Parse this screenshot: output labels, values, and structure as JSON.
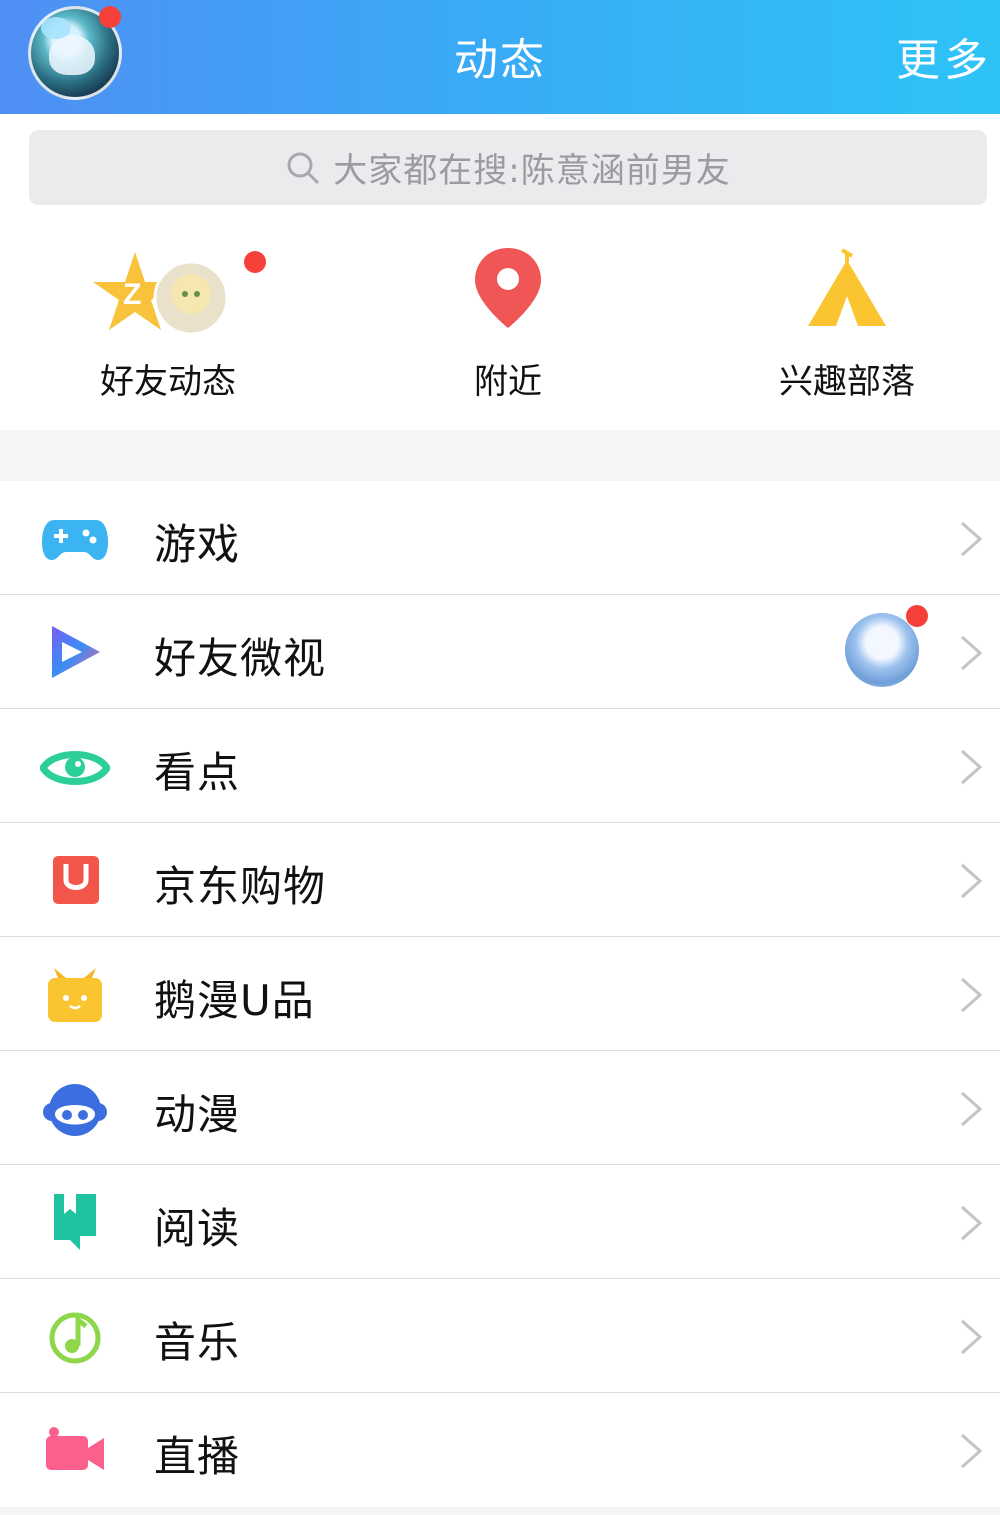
{
  "header": {
    "title": "动态",
    "more_label": "更多"
  },
  "search": {
    "placeholder": "大家都在搜:陈意涵前男友"
  },
  "quick_entries": [
    {
      "label": "好友动态",
      "icon": "qzone-star-icon"
    },
    {
      "label": "附近",
      "icon": "location-pin-icon"
    },
    {
      "label": "兴趣部落",
      "icon": "tent-icon"
    }
  ],
  "menu": [
    {
      "label": "游戏",
      "icon": "gamepad-icon"
    },
    {
      "label": "好友微视",
      "icon": "weishi-play-icon"
    },
    {
      "label": "看点",
      "icon": "eye-icon"
    },
    {
      "label": "京东购物",
      "icon": "shopping-bag-icon"
    },
    {
      "label": "鹅漫U品",
      "icon": "gift-box-icon"
    },
    {
      "label": "动漫",
      "icon": "anime-face-icon"
    },
    {
      "label": "阅读",
      "icon": "book-icon"
    },
    {
      "label": "音乐",
      "icon": "music-note-icon"
    },
    {
      "label": "直播",
      "icon": "video-camera-icon"
    }
  ],
  "colors": {
    "header_gradient_start": "#4f8ff4",
    "header_gradient_end": "#2ec3f7",
    "badge_red": "#f5413a",
    "pin_red": "#f05656",
    "tent_yellow": "#fbc531"
  }
}
